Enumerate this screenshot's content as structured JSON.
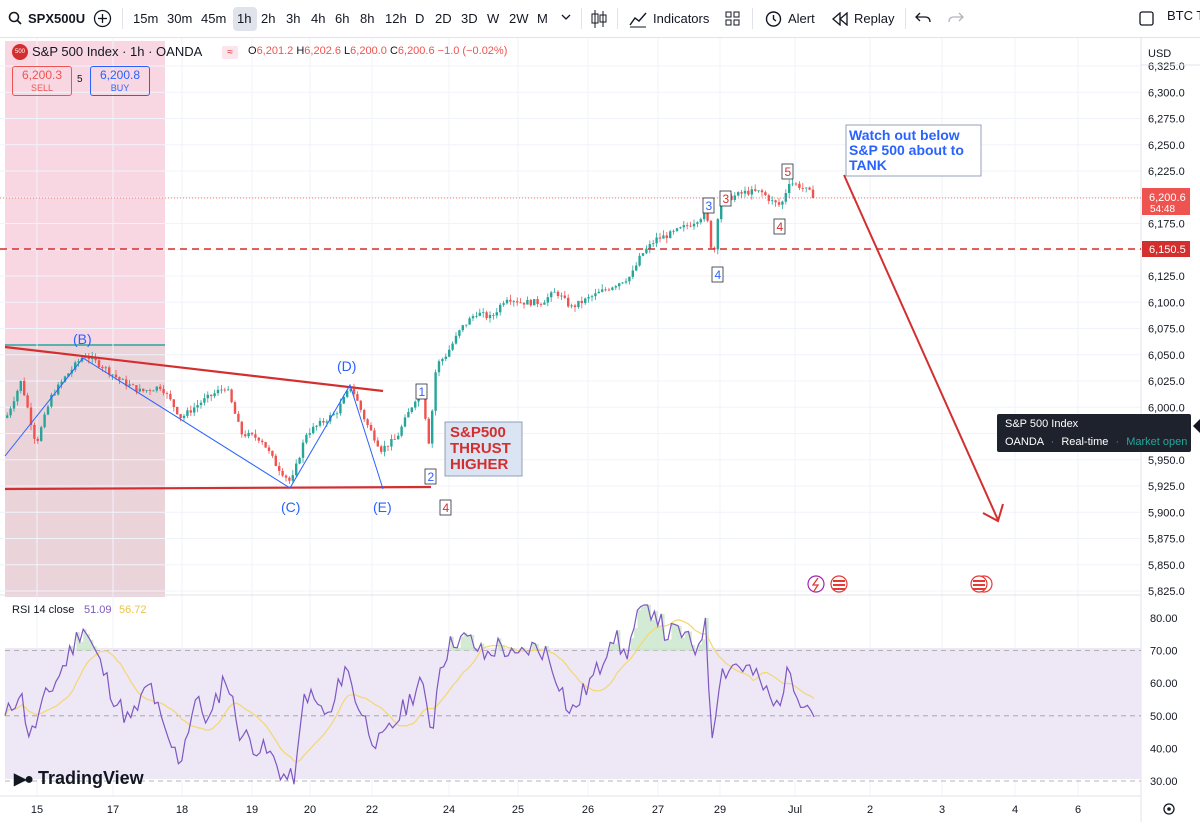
{
  "toolbar": {
    "symbol": "SPX500U",
    "intervals": [
      "15m",
      "30m",
      "45m",
      "1h",
      "2h",
      "3h",
      "4h",
      "6h",
      "8h",
      "12h",
      "D",
      "2D",
      "3D",
      "W",
      "2W",
      "M"
    ],
    "selected_interval": "1h",
    "indicators_label": "Indicators",
    "alert_label": "Alert",
    "replay_label": "Replay",
    "right_symbol": "BTC T"
  },
  "legend": {
    "badge": "500",
    "title": "S&P 500 Index · 1h · OANDA",
    "o_label": "O",
    "o_value": "6,201.2",
    "h_label": "H",
    "h_value": "6,202.6",
    "l_label": "L",
    "l_value": "6,200.0",
    "c_label": "C",
    "c_value": "6,200.6",
    "change": "−1.0 (−0.02%)",
    "sell_price": "6,200.3",
    "sell_label": "SELL",
    "spread": "5",
    "buy_price": "6,200.8",
    "buy_label": "BUY"
  },
  "price_axis": {
    "currency": "USD",
    "labels": [
      "6,325.0",
      "6,300.0",
      "6,275.0",
      "6,250.0",
      "6,225.0",
      "6,200.0",
      "6,175.0",
      "6,150.0",
      "6,125.0",
      "6,100.0",
      "6,075.0",
      "6,050.0",
      "6,025.0",
      "6,000.0",
      "5,975.0",
      "5,950.0",
      "5,925.0",
      "5,900.0",
      "5,875.0",
      "5,850.0",
      "5,825.0"
    ],
    "current_price": "6,200.6",
    "countdown": "54:48",
    "line_price": "6,150.5"
  },
  "time_axis": {
    "labels": [
      "15",
      "17",
      "18",
      "19",
      "20",
      "22",
      "24",
      "25",
      "26",
      "27",
      "29",
      "Jul",
      "2",
      "3",
      "4",
      "6"
    ]
  },
  "annotations": {
    "wave_b": "(B)",
    "wave_c": "(C)",
    "wave_d": "(D)",
    "wave_e": "(E)",
    "n1": "1",
    "n2": "2",
    "n3a": "3",
    "n3b": "3",
    "n4a": "4",
    "n4b": "4",
    "n4c": "4",
    "n5": "5",
    "thrust_l1": "S&P500",
    "thrust_l2": "THRUST",
    "thrust_l3": "HIGHER",
    "watch_l1": "Watch out below",
    "watch_l2": "S&P 500 about to",
    "watch_l3": "TANK"
  },
  "tooltip": {
    "title": "S&P 500 Index",
    "source": "OANDA",
    "dot": "·",
    "mode": "Real-time",
    "status": "Market open"
  },
  "rsi": {
    "label": "RSI 14 close",
    "value1": "51.09",
    "value2": "56.72",
    "axis_labels": [
      "80.00",
      "70.00",
      "60.00",
      "50.00",
      "40.00",
      "30.00"
    ]
  },
  "brand": "TradingView",
  "colors": {
    "up": "#26a69a",
    "down": "#ef5350",
    "annotation_red": "#d32f2f",
    "wave_blue": "#2962ff",
    "rsi_line": "#7e57c2",
    "rsi_ma": "#f5d76e",
    "rsi_band": "#ede7f6",
    "pink_zone": "#f8d7e3"
  },
  "chart_data": {
    "type": "candlestick",
    "y_range": [
      5812,
      6335
    ],
    "rsi_range": [
      27,
      85
    ],
    "rsi_levels": [
      70,
      50,
      30
    ],
    "current": 6200.6,
    "horizontal_line": 6150.5
  }
}
